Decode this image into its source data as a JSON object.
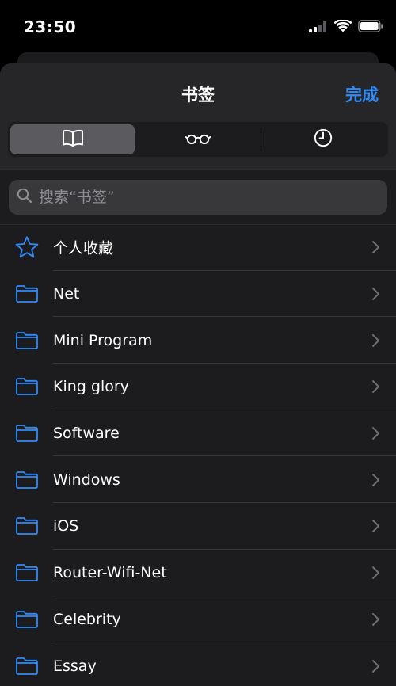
{
  "status_bar": {
    "time": "23:50"
  },
  "header": {
    "title": "书签",
    "done_label": "完成"
  },
  "segments": [
    {
      "icon": "book-icon",
      "selected": true
    },
    {
      "icon": "reading-glasses-icon",
      "selected": false
    },
    {
      "icon": "clock-icon",
      "selected": false
    }
  ],
  "search": {
    "placeholder": "搜索“书签”",
    "value": ""
  },
  "colors": {
    "accent": "#2f8bf7",
    "sheet_background": "#1c1c1e",
    "chevron": "#6e6e73"
  },
  "items": [
    {
      "icon": "star-icon",
      "label": "个人收藏"
    },
    {
      "icon": "folder-icon",
      "label": "Net"
    },
    {
      "icon": "folder-icon",
      "label": "Mini Program"
    },
    {
      "icon": "folder-icon",
      "label": "King glory"
    },
    {
      "icon": "folder-icon",
      "label": "Software"
    },
    {
      "icon": "folder-icon",
      "label": "Windows"
    },
    {
      "icon": "folder-icon",
      "label": "iOS"
    },
    {
      "icon": "folder-icon",
      "label": "Router-Wifi-Net"
    },
    {
      "icon": "folder-icon",
      "label": "Celebrity"
    },
    {
      "icon": "folder-icon",
      "label": "Essay"
    }
  ]
}
